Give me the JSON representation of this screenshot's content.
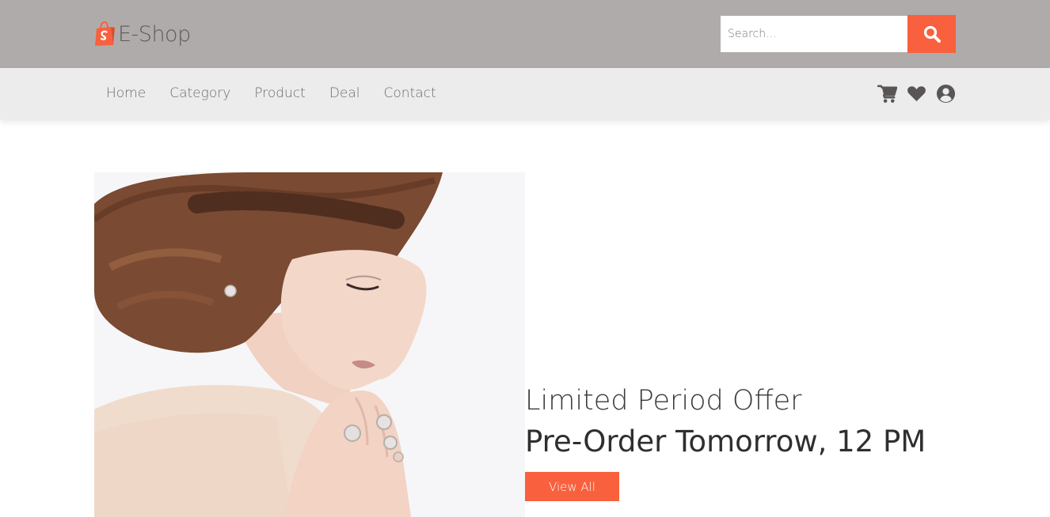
{
  "brand": {
    "name": "E-Shop",
    "icon": "shopify-bag-icon",
    "accent_color": "#f9603e"
  },
  "search": {
    "placeholder": "Search...",
    "button_icon": "search-icon"
  },
  "nav": {
    "items": [
      {
        "label": "Home"
      },
      {
        "label": "Category"
      },
      {
        "label": "Product"
      },
      {
        "label": "Deal"
      },
      {
        "label": "Contact"
      }
    ],
    "icons": [
      "cart-icon",
      "heart-icon",
      "user-circle-icon"
    ]
  },
  "hero": {
    "image": "woman-with-braided-hair-and-rings-photo",
    "offer_title": "Limited Period Offer",
    "offer_subtitle": "Pre-Order Tomorrow, 12 PM",
    "button_label": "View All"
  },
  "colors": {
    "header_bg": "#b0abab",
    "nav_bg": "#ececec",
    "icon_color": "#5a5555"
  }
}
